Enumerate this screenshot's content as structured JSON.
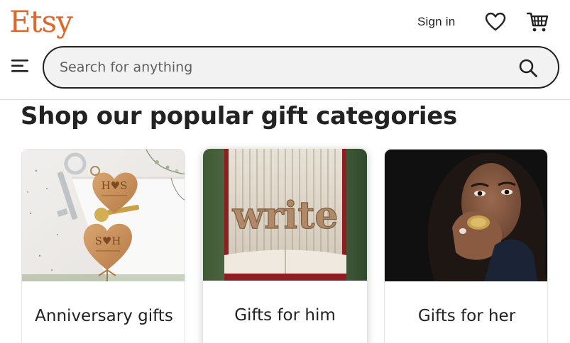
{
  "header": {
    "logo_text": "Etsy",
    "sign_in_label": "Sign in",
    "icons": {
      "favorites": "heart-icon",
      "cart": "cart-icon",
      "menu": "hamburger-menu-icon"
    }
  },
  "search": {
    "placeholder": "Search for anything",
    "value": "",
    "button_icon": "search-icon"
  },
  "section": {
    "title": "Shop our popular gift categories"
  },
  "categories": [
    {
      "label": "Anniversary gifts",
      "image": "wooden-heart-keyrings-photo"
    },
    {
      "label": "Gifts for him",
      "image": "folded-book-write-photo"
    },
    {
      "label": "Gifts for her",
      "image": "woman-with-ring-photo"
    }
  ],
  "colors": {
    "brand": "#e0662a",
    "text": "#222222",
    "search_bg": "#f2f2f2"
  }
}
